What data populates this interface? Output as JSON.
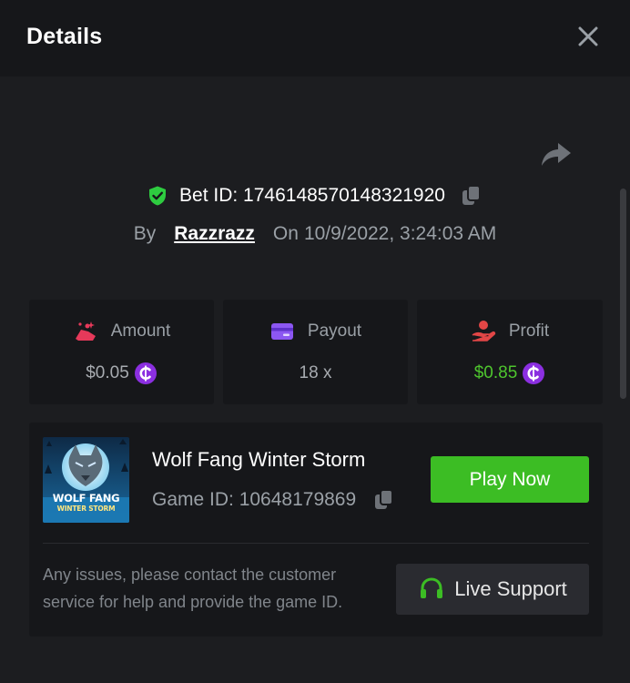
{
  "header": {
    "title": "Details"
  },
  "bet": {
    "id_label": "Bet ID: 1746148570148321920",
    "by_label": "By",
    "username": "Razzrazz",
    "on_label": "On",
    "datetime": "10/9/2022, 3:24:03 AM"
  },
  "stats": {
    "amount": {
      "label": "Amount",
      "value": "$0.05"
    },
    "payout": {
      "label": "Payout",
      "value": "18 x"
    },
    "profit": {
      "label": "Profit",
      "value": "$0.85"
    }
  },
  "game": {
    "title": "Wolf Fang Winter Storm",
    "id_label": "Game ID: 10648179869",
    "thumb_line1": "WOLF FANG",
    "thumb_line2": "WINTER STORM",
    "play_label": "Play Now"
  },
  "support": {
    "help_text": "Any issues, please contact the customer service for help and provide the game ID.",
    "button_label": "Live Support"
  },
  "colors": {
    "accent_green": "#3cbd24",
    "profit_green": "#4ec52e",
    "coin_purple": "#8b2fe0",
    "shield_green": "#2ecc40"
  },
  "icons": [
    "close-icon",
    "share-icon",
    "shield-check-icon",
    "copy-icon",
    "amount-icon",
    "payout-card-icon",
    "profit-hand-icon",
    "coin-icon",
    "headset-icon"
  ]
}
